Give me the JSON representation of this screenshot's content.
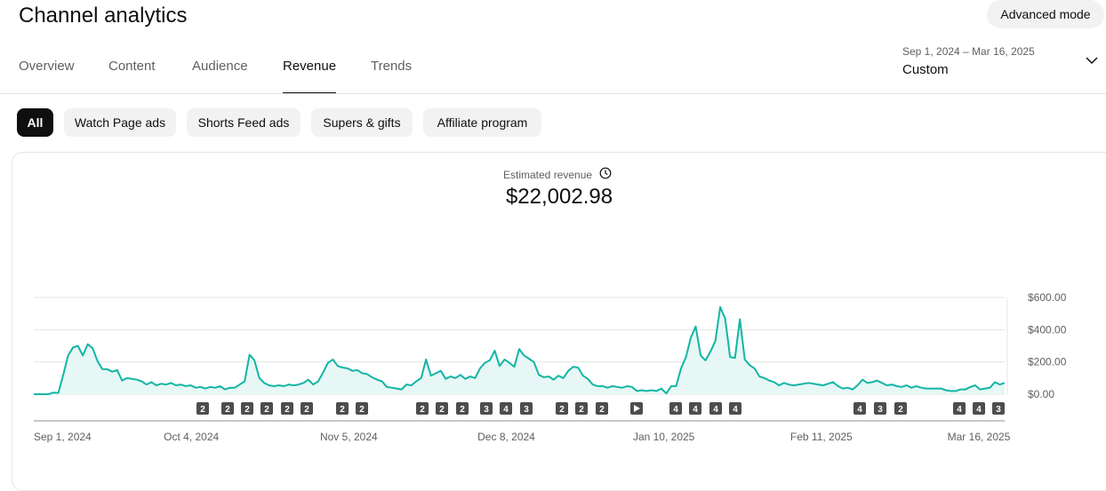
{
  "page": {
    "title": "Channel analytics",
    "advanced_mode_label": "Advanced mode"
  },
  "tabs": [
    {
      "label": "Overview",
      "active": false
    },
    {
      "label": "Content",
      "active": false
    },
    {
      "label": "Audience",
      "active": false
    },
    {
      "label": "Revenue",
      "active": true
    },
    {
      "label": "Trends",
      "active": false
    }
  ],
  "date_range": {
    "dates": "Sep 1, 2024 – Mar 16, 2025",
    "preset": "Custom",
    "icon": "chevron-down-icon"
  },
  "filter_chips": [
    {
      "label": "All",
      "active": true
    },
    {
      "label": "Watch Page ads",
      "active": false
    },
    {
      "label": "Shorts Feed ads",
      "active": false
    },
    {
      "label": "Supers & gifts",
      "active": false
    },
    {
      "label": "Affiliate program",
      "active": false
    }
  ],
  "metric": {
    "label": "Estimated revenue",
    "value": "$22,002.98",
    "icon": "clock-icon"
  },
  "colors": {
    "accent": "#12b5a5",
    "fill": "#e6f7f5",
    "chip_active": "#0f0f0f",
    "chip_bg": "#f2f2f2",
    "marker": "#4d4d4d"
  },
  "chart_data": {
    "type": "area",
    "y_tick_labels": [
      "$600.00",
      "$400.00",
      "$200.00",
      "$0.00"
    ],
    "y_ticks": [
      600,
      400,
      200,
      0
    ],
    "ylim": [
      0,
      600
    ],
    "grid": true,
    "x_tick_labels": [
      "Sep 1, 2024",
      "Oct 4, 2024",
      "Nov 5, 2024",
      "Dec 8, 2024",
      "Jan 10, 2025",
      "Feb 11, 2025",
      "Mar 16, 2025"
    ],
    "series": [
      {
        "values": [
          0,
          0,
          0,
          0,
          10,
          8,
          120,
          240,
          290,
          300,
          240,
          310,
          285,
          205,
          155,
          155,
          140,
          150,
          85,
          100,
          95,
          90,
          80,
          60,
          75,
          55,
          65,
          60,
          70,
          55,
          60,
          50,
          55,
          40,
          45,
          35,
          45,
          40,
          50,
          30,
          40,
          40,
          60,
          80,
          245,
          210,
          100,
          70,
          55,
          50,
          55,
          50,
          60,
          55,
          60,
          70,
          90,
          60,
          80,
          135,
          195,
          215,
          175,
          165,
          160,
          145,
          150,
          130,
          125,
          105,
          90,
          80,
          45,
          40,
          35,
          30,
          60,
          55,
          80,
          100,
          215,
          115,
          130,
          145,
          95,
          110,
          100,
          120,
          95,
          110,
          100,
          160,
          195,
          210,
          270,
          175,
          215,
          195,
          170,
          280,
          240,
          220,
          200,
          120,
          105,
          110,
          90,
          115,
          100,
          145,
          170,
          165,
          115,
          95,
          60,
          50,
          50,
          40,
          50,
          45,
          40,
          50,
          45,
          20,
          25,
          20,
          25,
          20,
          35,
          5,
          50,
          50,
          160,
          230,
          350,
          420,
          240,
          210,
          265,
          330,
          540,
          470,
          230,
          225,
          465,
          215,
          180,
          160,
          110,
          100,
          85,
          75,
          55,
          70,
          60,
          55,
          60,
          65,
          70,
          65,
          60,
          55,
          65,
          75,
          50,
          35,
          40,
          30,
          55,
          90,
          70,
          75,
          85,
          70,
          55,
          60,
          50,
          45,
          55,
          40,
          50,
          40,
          35,
          35,
          35,
          35,
          25,
          20,
          20,
          30,
          30,
          45,
          55,
          30,
          35,
          40,
          75,
          60,
          70
        ]
      }
    ],
    "markers": [
      {
        "label": "2",
        "kind": "count"
      },
      {
        "label": "2",
        "kind": "count"
      },
      {
        "label": "2",
        "kind": "count"
      },
      {
        "label": "2",
        "kind": "count"
      },
      {
        "label": "2",
        "kind": "count"
      },
      {
        "label": "2",
        "kind": "count"
      },
      {
        "label": "2",
        "kind": "count"
      },
      {
        "label": "2",
        "kind": "count"
      },
      {
        "label": "2",
        "kind": "count"
      },
      {
        "label": "2",
        "kind": "count"
      },
      {
        "label": "2",
        "kind": "count"
      },
      {
        "label": "3",
        "kind": "count"
      },
      {
        "label": "4",
        "kind": "count"
      },
      {
        "label": "3",
        "kind": "count"
      },
      {
        "label": "2",
        "kind": "count"
      },
      {
        "label": "2",
        "kind": "count"
      },
      {
        "label": "2",
        "kind": "count"
      },
      {
        "label": "",
        "kind": "play"
      },
      {
        "label": "4",
        "kind": "count"
      },
      {
        "label": "4",
        "kind": "count"
      },
      {
        "label": "4",
        "kind": "count"
      },
      {
        "label": "4",
        "kind": "count"
      },
      {
        "label": "4",
        "kind": "count"
      },
      {
        "label": "3",
        "kind": "count"
      },
      {
        "label": "2",
        "kind": "count"
      },
      {
        "label": "4",
        "kind": "count"
      },
      {
        "label": "4",
        "kind": "count"
      },
      {
        "label": "3",
        "kind": "count"
      }
    ]
  }
}
